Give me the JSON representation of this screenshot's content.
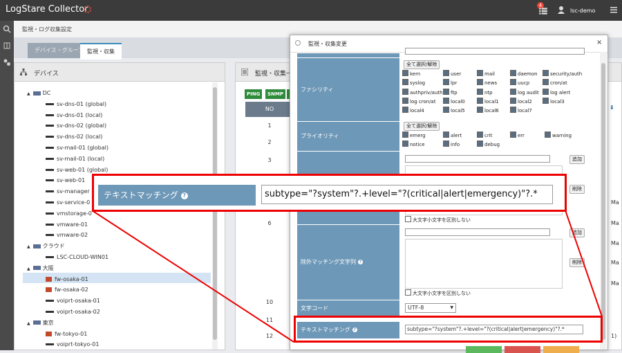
{
  "app": {
    "title": "LogStare Collector",
    "notification_count": "4",
    "user": "lsc-demo"
  },
  "breadcrumb": "監視・ログ収集設定",
  "tabs": [
    {
      "label": "デバイス・グループ"
    },
    {
      "label": "監視・収集"
    }
  ],
  "device_panel": {
    "title": "デバイス",
    "tree": [
      {
        "label": "DC",
        "type": "group"
      },
      {
        "label": "sv-dns-01 (global)",
        "type": "server"
      },
      {
        "label": "sv-dns-01 (local)",
        "type": "server"
      },
      {
        "label": "sv-dns-02 (global)",
        "type": "server"
      },
      {
        "label": "sv-dns-02 (local)",
        "type": "server"
      },
      {
        "label": "sv-mail-01 (global)",
        "type": "server"
      },
      {
        "label": "sv-mail-01 (local)",
        "type": "server"
      },
      {
        "label": "sv-web-01 (global)",
        "type": "server"
      },
      {
        "label": "sv-web-01",
        "type": "server"
      },
      {
        "label": "sv-manager",
        "type": "server"
      },
      {
        "label": "sv-service-0",
        "type": "server"
      },
      {
        "label": "vmstorage-0",
        "type": "server"
      },
      {
        "label": "vmware-01",
        "type": "server"
      },
      {
        "label": "vmware-02",
        "type": "server"
      },
      {
        "label": "クラウド",
        "type": "group"
      },
      {
        "label": "LSC-CLOUD-WIN01",
        "type": "server"
      },
      {
        "label": "大阪",
        "type": "group"
      },
      {
        "label": "fw-osaka-01",
        "type": "fw"
      },
      {
        "label": "fw-osaka-02",
        "type": "fw"
      },
      {
        "label": "voiprt-osaka-01",
        "type": "server"
      },
      {
        "label": "voiprt-osaka-02",
        "type": "server"
      },
      {
        "label": "東京",
        "type": "group"
      },
      {
        "label": "fw-tokyo-01",
        "type": "fw"
      },
      {
        "label": "voiprt-tokyo-01",
        "type": "server"
      }
    ]
  },
  "monitor_panel": {
    "title": "監視・収集一",
    "protocols": [
      "PING",
      "SNMP"
    ],
    "col_no": "NO",
    "rows": [
      "1",
      "2",
      "3",
      "6",
      "10",
      "11",
      "12"
    ],
    "right_snippets": [
      "Ma",
      "Ma",
      "Ma",
      "Ma",
      "Ma",
      "1)"
    ]
  },
  "modal": {
    "title": "監視・収集変更",
    "facility": {
      "label": "ファシリティ",
      "select_all": "全て選択/解除",
      "items": [
        "kern",
        "user",
        "mail",
        "daemon",
        "security/auth",
        "syslog",
        "lpr",
        "news",
        "uucp",
        "cron/at",
        "authpriv/auth",
        "ftp",
        "ntp",
        "log audit",
        "log alert",
        "log cron/at",
        "local0",
        "local1",
        "local2",
        "local3",
        "local4",
        "local5",
        "local6",
        "local7"
      ]
    },
    "priority": {
      "label": "プライオリティ",
      "select_all": "全て選択/解除",
      "items": [
        "emerg",
        "alert",
        "crit",
        "err",
        "warning",
        "notice",
        "info",
        "debug"
      ]
    },
    "match": {
      "add": "追加",
      "delete": "削除",
      "case_insensitive": "大文字小文字を区別しない"
    },
    "exclude": {
      "label": "除外マッチング文字列",
      "add": "追加",
      "delete": "削除",
      "case_insensitive": "大文字小文字を区別しない"
    },
    "charset": {
      "label": "文字コード",
      "value": "UTF-8"
    },
    "text_match": {
      "label": "テキストマッチング",
      "value": "subtype=\"?system\"?.+level=\"?(critical|alert|emergency)\"?.*"
    }
  },
  "callout": {
    "label": "テキストマッチング",
    "value": "subtype=\"?system\"?.+level=\"?(critical|alert|emergency)\"?.*"
  },
  "colors": {
    "label_bg": "#6e98b8",
    "highlight": "#e00000",
    "header": "#3b3b3b"
  }
}
